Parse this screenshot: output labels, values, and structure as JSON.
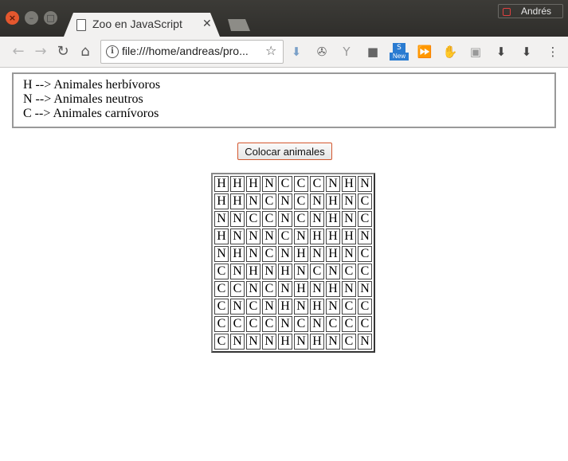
{
  "window": {
    "tab_title": "Zoo en JavaScript",
    "profile_name": "Andrés"
  },
  "toolbar": {
    "url": "file:///home/andreas/pro...",
    "new_badge": "New"
  },
  "legend": {
    "lines": [
      "H --> Animales herbívoros",
      "N --> Animales neutros",
      "C --> Animales carnívoros"
    ]
  },
  "button": {
    "label": "Colocar animales"
  },
  "grid": [
    [
      "H",
      "H",
      "H",
      "N",
      "C",
      "C",
      "C",
      "N",
      "H",
      "N"
    ],
    [
      "H",
      "H",
      "N",
      "C",
      "N",
      "C",
      "N",
      "H",
      "N",
      "C"
    ],
    [
      "N",
      "N",
      "C",
      "C",
      "N",
      "C",
      "N",
      "H",
      "N",
      "C"
    ],
    [
      "H",
      "N",
      "N",
      "N",
      "C",
      "N",
      "H",
      "H",
      "H",
      "N"
    ],
    [
      "N",
      "H",
      "N",
      "C",
      "N",
      "H",
      "N",
      "H",
      "N",
      "C"
    ],
    [
      "C",
      "N",
      "H",
      "N",
      "H",
      "N",
      "C",
      "N",
      "C",
      "C"
    ],
    [
      "C",
      "C",
      "N",
      "C",
      "N",
      "H",
      "N",
      "H",
      "N",
      "N"
    ],
    [
      "C",
      "N",
      "C",
      "N",
      "H",
      "N",
      "H",
      "N",
      "C",
      "C"
    ],
    [
      "C",
      "C",
      "C",
      "C",
      "N",
      "C",
      "N",
      "C",
      "C",
      "C"
    ],
    [
      "C",
      "N",
      "N",
      "N",
      "H",
      "N",
      "H",
      "N",
      "C",
      "N"
    ]
  ]
}
